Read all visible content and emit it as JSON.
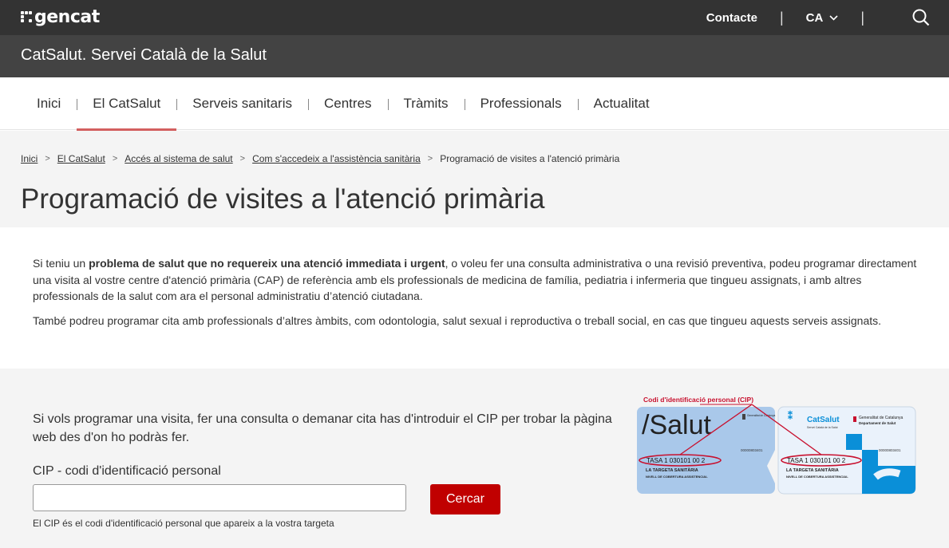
{
  "header": {
    "logo_text": "gencat",
    "contact_label": "Contacte",
    "language": "CA",
    "separator": "|"
  },
  "site": {
    "title": "CatSalut. Servei Català de la Salut"
  },
  "nav": {
    "items": [
      {
        "label": "Inici"
      },
      {
        "label": "El CatSalut",
        "active": true
      },
      {
        "label": "Serveis sanitaris"
      },
      {
        "label": "Centres"
      },
      {
        "label": "Tràmits"
      },
      {
        "label": "Professionals"
      },
      {
        "label": "Actualitat"
      }
    ]
  },
  "breadcrumb": {
    "items": [
      "Inici",
      "El CatSalut",
      "Accés al sistema de salut",
      "Com s'accedeix a l'assistència sanitària"
    ],
    "current": "Programació de visites a l'atenció primària"
  },
  "page": {
    "title": "Programació de visites a l'atenció primària"
  },
  "intro": {
    "p1_before": "Si teniu un ",
    "p1_bold": "problema de salut que no requereix una atenció immediata i urgent",
    "p1_after": ", o voleu fer una consulta administrativa o una revisió preventiva, podeu programar directament una visita al vostre centre d'atenció primària (CAP) de referència amb els professionals de medicina de família, pediatria i infermeria que tingueu assignats, i amb altres professionals de la salut com ara el personal administratiu d’atenció ciutadana.",
    "p2": "També podreu programar cita amb professionals d’altres àmbits, com odontologia, salut sexual i reproductiva o treball social, en cas que tingueu aquests serveis assignats."
  },
  "search": {
    "lead": "Si vols programar una visita, fer una consulta o demanar cita has d'introduir el CIP per trobar la pàgina web des d'on ho podràs fer.",
    "label": "CIP - codi d'identificació personal",
    "value": "",
    "button": "Cercar",
    "help": "El CIP és el codi d'identificació personal que apareix a la vostra targeta"
  },
  "cards": {
    "caption": "Codi d'identificació personal (CIP)",
    "card1": {
      "brand": "/Salut",
      "issuer": "Generalitat de Catalunya",
      "number": "00000803401",
      "cip": "TASA 1 030101 00 2",
      "line1": "LA TARGETA SANITÀRIA",
      "line2": "NIVELL DE COBERTURA ASSISTENCIAL"
    },
    "card2": {
      "brand": "CatSalut",
      "brand_sub": "Servei Català de la Salut",
      "issuer": "Generalitat de Catalunya",
      "issuer_sub": "Departament de Salut",
      "number": "00000803401",
      "cip": "TASA 1 030101 00 2",
      "line1": "LA TARGETA SANITÀRIA",
      "line2": "NIVELL DE COBERTURA ASSISTENCIAL"
    },
    "colors": {
      "annotation": "#c8102e",
      "card1_bg": "#a9c8ea",
      "card2_bg": "#eaf2fb",
      "card2_accent": "#0a8fd8"
    }
  }
}
